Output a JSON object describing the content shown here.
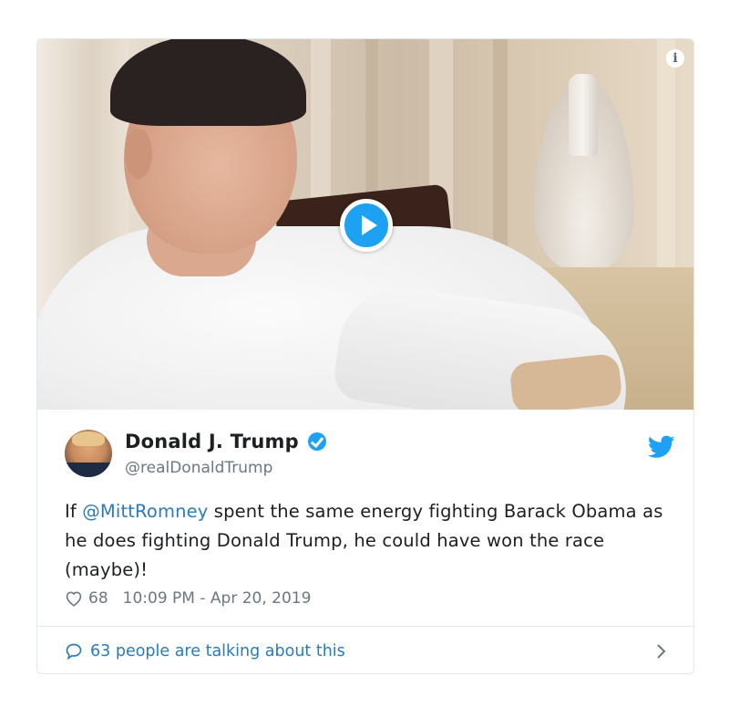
{
  "tweet": {
    "display_name": "Donald J. Trump",
    "handle": "@realDonaldTrump",
    "text_prefix": "If ",
    "mention": "@MittRomney",
    "text_rest": " spent the same energy fighting Barack Obama as he does fighting Donald Trump, he could have won the race (maybe)!",
    "likes": "68",
    "timestamp": "10:09 PM - Apr 20, 2019",
    "talking": "63 people are talking about this"
  },
  "icons": {
    "play": "play-icon",
    "info": "info-icon",
    "verified": "verified-badge-icon",
    "twitter": "twitter-bird-icon",
    "heart": "heart-icon",
    "comment": "speech-bubble-icon",
    "chevron": "chevron-right-icon"
  },
  "colors": {
    "accent": "#1da1f2",
    "link": "#2b7bb9",
    "muted": "#697882",
    "text": "#1c2022"
  }
}
